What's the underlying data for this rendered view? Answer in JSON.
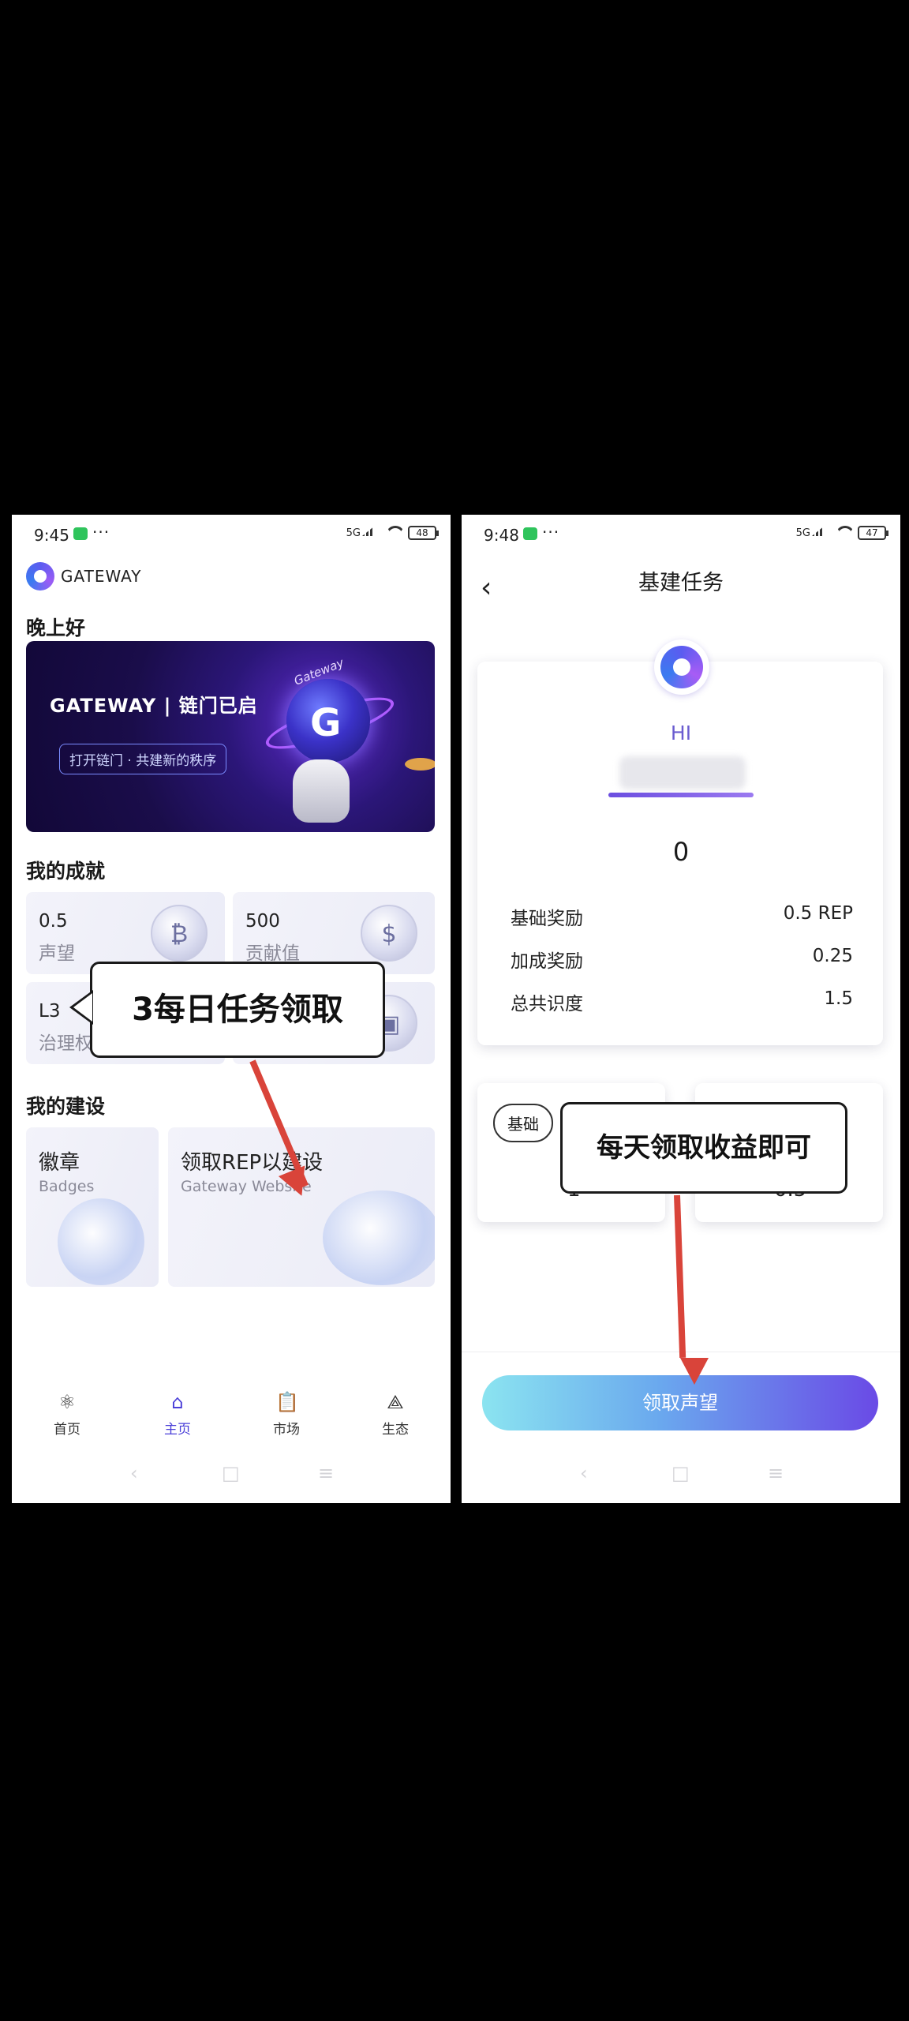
{
  "left": {
    "status": {
      "time": "9:45",
      "network": "5G",
      "battery": "48"
    },
    "brand": "GATEWAY",
    "greeting": "晚上好",
    "banner": {
      "title": "GATEWAY | 链门已启",
      "pill": "打开链门 · 共建新的秩序",
      "planet_text": "Gateway"
    },
    "achievements_title": "我的成就",
    "achievements": [
      {
        "value": "0.5",
        "label": "声望",
        "icon": "refresh-coin-icon"
      },
      {
        "value": "500",
        "label": "贡献值",
        "icon": "dollar-up-icon"
      },
      {
        "value": "L3",
        "label": "治理权",
        "icon": "wallet-icon"
      }
    ],
    "build_title": "我的建设",
    "build_cards": [
      {
        "title": "徽章",
        "subtitle": "Badges"
      },
      {
        "title": "领取REP以建设",
        "subtitle": "Gateway Website"
      }
    ],
    "tabs": [
      {
        "label": "首页",
        "icon": "atom-icon"
      },
      {
        "label": "主页",
        "icon": "home-icon"
      },
      {
        "label": "市场",
        "icon": "chart-icon"
      },
      {
        "label": "生态",
        "icon": "ecosystem-icon"
      }
    ],
    "callout": "3每日任务领取"
  },
  "right": {
    "status": {
      "time": "9:48",
      "network": "5G",
      "battery": "47"
    },
    "title": "基建任务",
    "hi": "HI",
    "rep_value": "0",
    "rows": [
      {
        "label": "基础奖励",
        "value": "0.5 REP"
      },
      {
        "label": "加成奖励",
        "value": "0.25"
      },
      {
        "label": "总共识度",
        "value": "1.5"
      }
    ],
    "small_cards": [
      {
        "tag": "基础",
        "value": "1"
      },
      {
        "tag": "",
        "value": "0.5"
      }
    ],
    "callout": "每天领取收益即可",
    "claim_button": "领取声望"
  },
  "colors": {
    "accent": "#4a3fd8",
    "arrow": "#d9443a"
  }
}
